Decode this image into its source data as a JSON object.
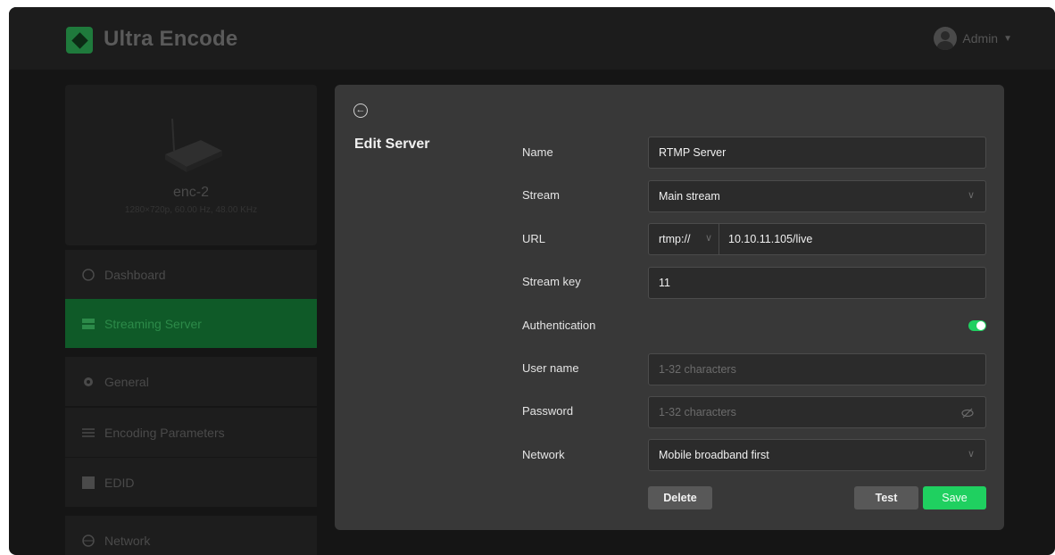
{
  "header": {
    "app_title": "Ultra Encode",
    "user_name": "Admin"
  },
  "device": {
    "name": "enc-2",
    "spec": "1280×720p, 60.00 Hz, 48.00 KHz"
  },
  "sidebar": {
    "items": [
      {
        "label": "Dashboard",
        "icon": "dashboard-icon"
      },
      {
        "label": "Streaming Server",
        "icon": "server-icon",
        "active": true
      },
      {
        "label": "General",
        "icon": "gear-icon"
      },
      {
        "label": "Encoding Parameters",
        "icon": "sliders-icon"
      },
      {
        "label": "EDID",
        "icon": "edid-icon"
      },
      {
        "label": "Network",
        "icon": "globe-icon"
      }
    ]
  },
  "modal": {
    "title": "Edit Server",
    "fields": {
      "name": {
        "label": "Name",
        "value": "RTMP Server"
      },
      "stream": {
        "label": "Stream",
        "value": "Main stream"
      },
      "url": {
        "label": "URL",
        "protocol": "rtmp://",
        "host": "10.10.11.105/live"
      },
      "stream_key": {
        "label": "Stream key",
        "value": "11"
      },
      "authentication": {
        "label": "Authentication",
        "enabled": true
      },
      "user_name": {
        "label": "User name",
        "placeholder": "1-32 characters"
      },
      "password": {
        "label": "Password",
        "placeholder": "1-32 characters"
      },
      "network": {
        "label": "Network",
        "value": "Mobile broadband first"
      }
    },
    "buttons": {
      "delete": "Delete",
      "test": "Test",
      "save": "Save"
    }
  },
  "colors": {
    "accent": "#1fd060",
    "active_nav": "#0f5a28",
    "modal_bg": "#383838"
  }
}
